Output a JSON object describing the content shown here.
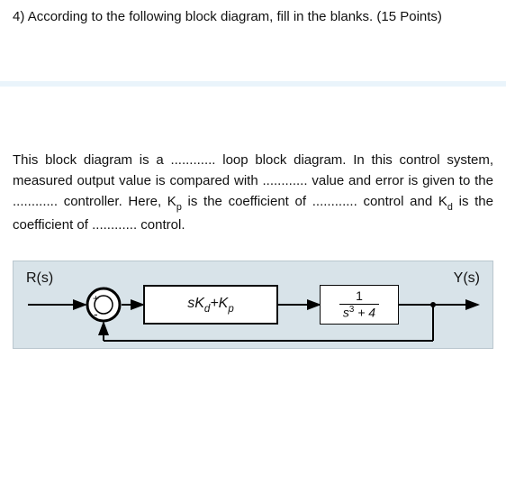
{
  "question": {
    "number": "4)",
    "prompt": "According to the following block diagram, fill in the blanks. (15 Points)"
  },
  "paragraph": {
    "s1a": "This block diagram is a ",
    "blank": "............",
    "s1b": " loop block diagram. In this control system, measured output value is compared with ",
    "s2a": " value and error is given to the ",
    "s2b": " controller. Here, K",
    "sub_p": "p",
    "s3a": " is the coefficient of ",
    "s3b": " control and K",
    "sub_d": "d",
    "s4a": " is the coefficient of ",
    "s4b": " control."
  },
  "diagram": {
    "input_label": "R(s)",
    "output_label": "Y(s)",
    "sum_plus": "+",
    "sum_minus": "-",
    "controller_expr_prefix": "sK",
    "controller_sub1": "d",
    "controller_plus": "+K",
    "controller_sub2": "p",
    "plant_num": "1",
    "plant_den_s": "s",
    "plant_den_exp": "3",
    "plant_den_rest": " + 4"
  }
}
